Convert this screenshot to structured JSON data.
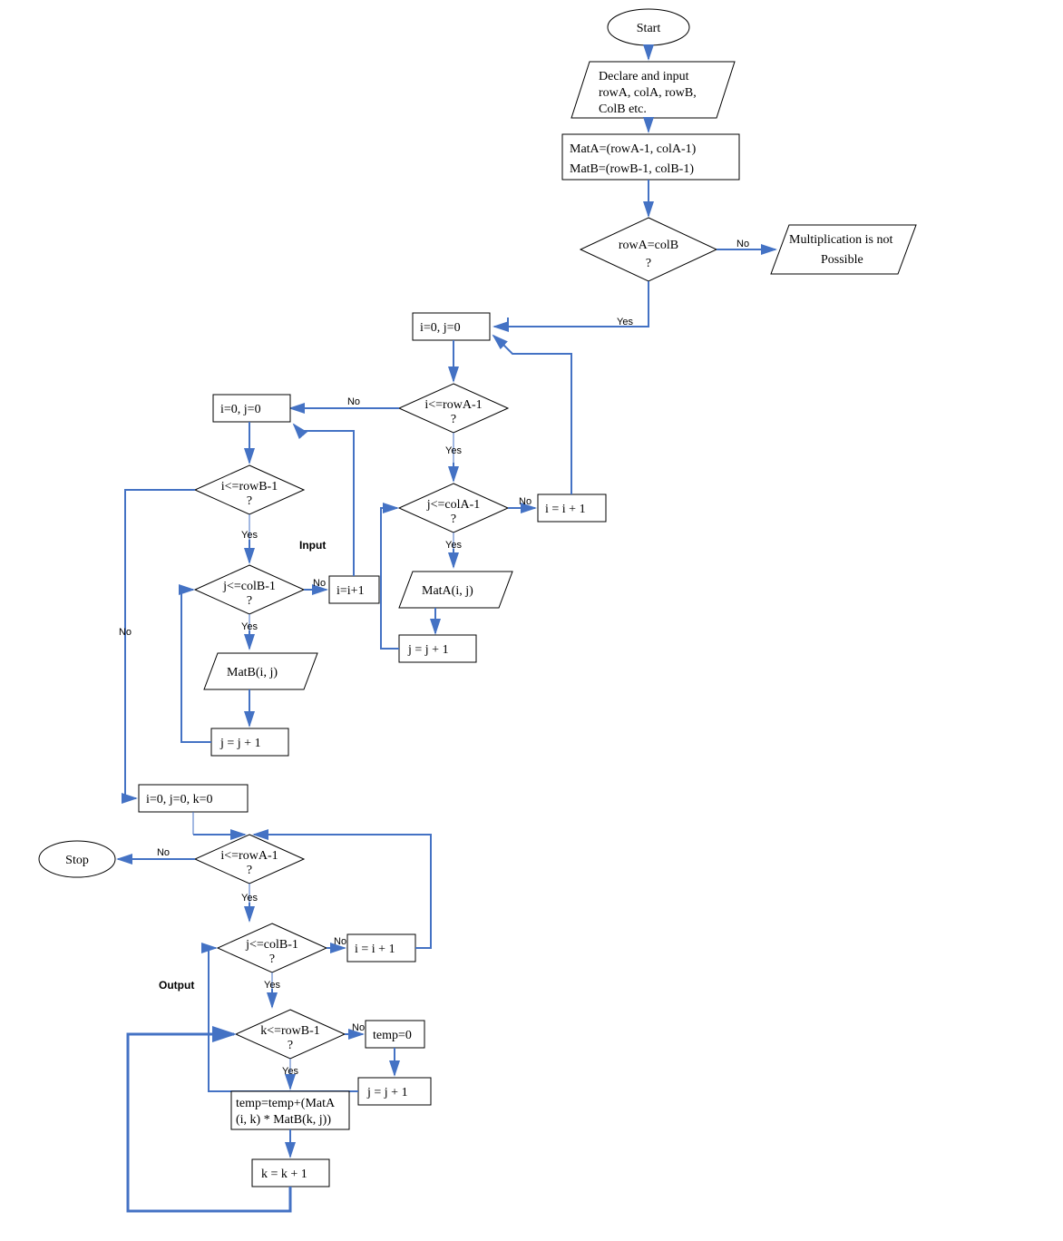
{
  "start": "Start",
  "declare": "Declare and input rowA, colA, rowB, ColB etc.",
  "initMat1": "MatA=(rowA-1, colA-1)",
  "initMat2": "MatB=(rowB-1, colB-1)",
  "checkRowCol": "rowA=colB ?",
  "multNot1": "Multiplication is not",
  "multNot2": "Possible",
  "ij0": "i=0, j=0",
  "iRowA": "i<=rowA-1 ?",
  "jColA": "j<=colA-1 ?",
  "iPlus1": "i = i + 1",
  "matAij": "MatA(i, j)",
  "jPlus1": "j = j + 1",
  "ij0b": "i=0,  j=0",
  "iRowB": "i<=rowB-1 ?",
  "jColB": "j<=colB-1 ?",
  "iPlus1b": "i=i+1",
  "matBij": "MatB(i, j)",
  "jPlus1b": "j = j + 1",
  "inputLabel": "Input",
  "ijk0": "i=0, j=0, k=0",
  "iRowA2": "i<=rowA-1 ?",
  "stop": "Stop",
  "jColB2": "j<=colB-1 ?",
  "iPlus1c": "i = i + 1",
  "kRowB": "k<=rowB-1 ?",
  "temp0": "temp=0",
  "jPlus1c": "j = j + 1",
  "tempCalc1": "temp=temp+(MatA",
  "tempCalc2": "(i, k) * MatB(k, j))",
  "kPlus1": "k = k + 1",
  "outputLabel": "Output",
  "yes": "Yes",
  "no": "No"
}
